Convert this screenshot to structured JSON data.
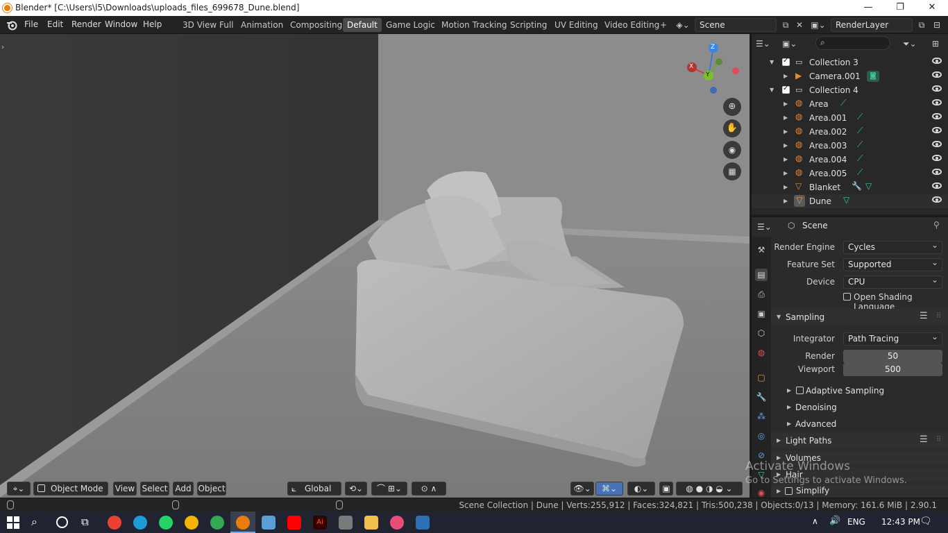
{
  "window": {
    "title": "Blender* [C:\\Users\\l5\\Downloads\\uploads_files_699678_Dune.blend]",
    "min": "—",
    "max": "❐",
    "close": "✕"
  },
  "menu": [
    "File",
    "Edit",
    "Render",
    "Window",
    "Help"
  ],
  "workspaces": [
    "3D View Full",
    "Animation",
    "Compositing",
    "Default",
    "Game Logic",
    "Motion Tracking",
    "Scripting",
    "UV Editing",
    "Video Editing",
    "+"
  ],
  "active_workspace": "Default",
  "scene_field": "Scene",
  "view_layer_field": "RenderLayer",
  "outliner": {
    "search_placeholder": "",
    "rows": [
      {
        "label": "Collection 3",
        "type": "collection"
      },
      {
        "label": "Camera.001",
        "type": "camera"
      },
      {
        "label": "Collection 4",
        "type": "collection"
      },
      {
        "label": "Area",
        "type": "light"
      },
      {
        "label": "Area.001",
        "type": "light"
      },
      {
        "label": "Area.002",
        "type": "light"
      },
      {
        "label": "Area.003",
        "type": "light"
      },
      {
        "label": "Area.004",
        "type": "light"
      },
      {
        "label": "Area.005",
        "type": "light"
      },
      {
        "label": "Blanket",
        "type": "mesh"
      },
      {
        "label": "Dune",
        "type": "mesh"
      }
    ]
  },
  "properties": {
    "context": "Scene",
    "render_engine_label": "Render Engine",
    "render_engine": "Cycles",
    "feature_set_label": "Feature Set",
    "feature_set": "Supported",
    "device_label": "Device",
    "device": "CPU",
    "osl_label": "Open Shading Language",
    "sampling_label": "Sampling",
    "integrator_label": "Integrator",
    "integrator": "Path Tracing",
    "render_label": "Render",
    "render_samples": "50",
    "viewport_label": "Viewport",
    "viewport_samples": "500",
    "adaptive_label": "Adaptive Sampling",
    "denoising_label": "Denoising",
    "advanced_label": "Advanced",
    "light_paths_label": "Light Paths",
    "volumes_label": "Volumes",
    "hair_label": "Hair",
    "simplify_label": "Simplify"
  },
  "viewport_header": {
    "mode": "Object Mode",
    "view": "View",
    "select": "Select",
    "add": "Add",
    "object": "Object",
    "orientation": "Global"
  },
  "gizmo": {
    "x": "X",
    "y": "Y",
    "z": "Z"
  },
  "status": "Scene Collection | Dune | Verts:255,912 | Faces:324,821 | Tris:500,238 | Objects:0/13 | Memory: 161.6 MiB | 2.90.1",
  "watermark": {
    "line1": "Activate Windows",
    "line2": "Go to Settings to activate Windows."
  },
  "taskbar": {
    "lang": "ENG",
    "time": "12:43 PM"
  },
  "colors": {
    "accent": "#e87d0d",
    "light_icon": "#d98d3f",
    "mesh_green": "#3fc4a0",
    "active_tab": "#4a4a4a"
  }
}
